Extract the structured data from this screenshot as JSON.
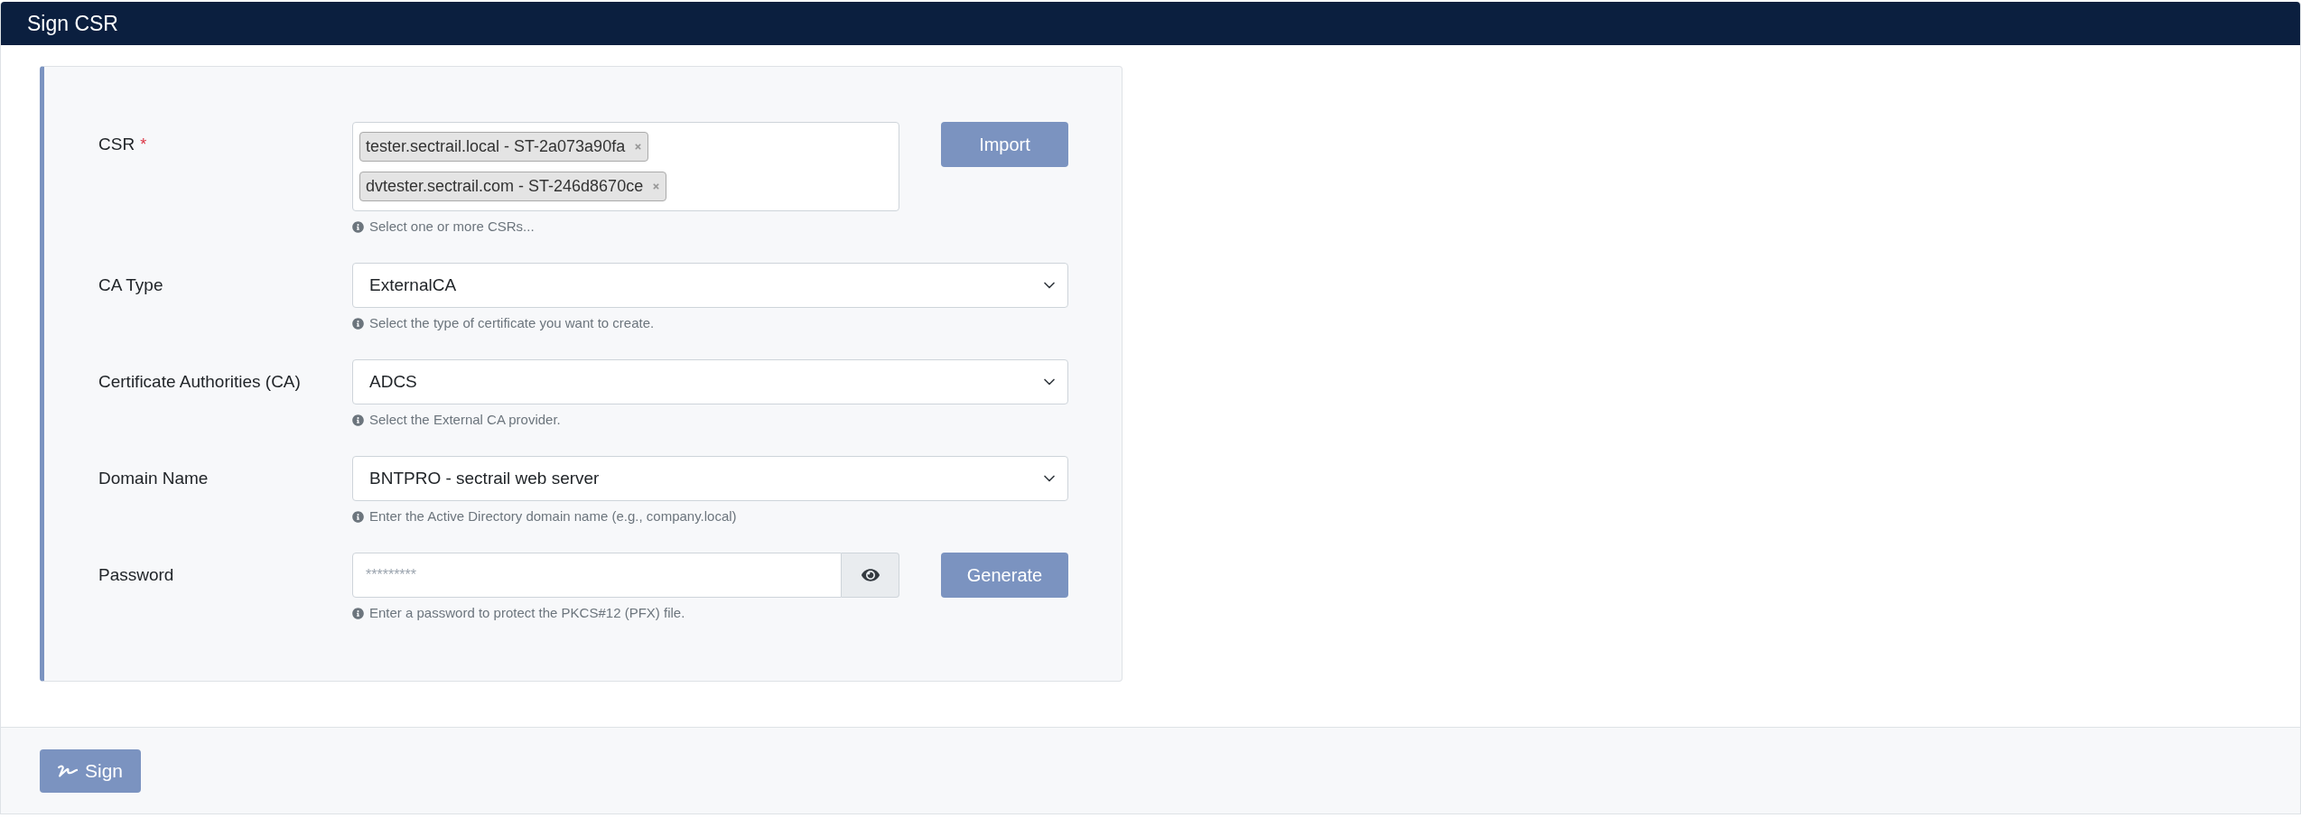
{
  "header": {
    "title": "Sign CSR"
  },
  "form": {
    "fields": [
      {
        "kind": "tags",
        "label": "CSR",
        "required_mark": "*",
        "tags": [
          {
            "text": "tester.sectrail.local - ST-2a073a90fa"
          },
          {
            "text": "dvtester.sectrail.com - ST-246d8670ce"
          }
        ],
        "help": "Select one or more CSRs...",
        "button": {
          "label": "Import"
        }
      },
      {
        "kind": "select",
        "label": "CA Type",
        "value": "ExternalCA",
        "help": "Select the type of certificate you want to create."
      },
      {
        "kind": "select",
        "label": "Certificate Authorities (CA)",
        "value": "ADCS",
        "help": "Select the External CA provider."
      },
      {
        "kind": "select",
        "label": "Domain Name",
        "value": "BNTPRO - sectrail web server",
        "help": "Enter the Active Directory domain name (e.g., company.local)"
      },
      {
        "kind": "password",
        "label": "Password",
        "placeholder": "*********",
        "help": "Enter a password to protect the PKCS#12 (PFX) file.",
        "button": {
          "label": "Generate"
        }
      }
    ]
  },
  "footer": {
    "button": {
      "label": "Sign"
    }
  }
}
